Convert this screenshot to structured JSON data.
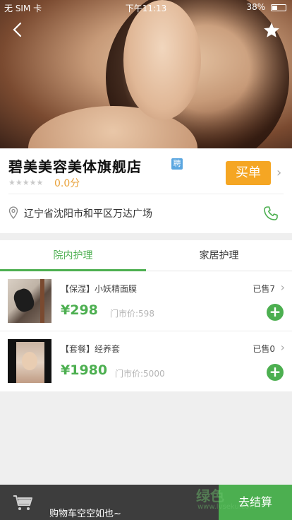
{
  "status_bar": {
    "carrier": "无 SIM 卡",
    "time": "下午11:13",
    "battery": "38%"
  },
  "store": {
    "name": "碧美美容美体旗舰店",
    "badge": "聘",
    "stars_display": "★★★★★",
    "rating": "0.0分",
    "buy_label": "买单",
    "address": "辽宁省沈阳市和平区万达广场"
  },
  "tabs": [
    {
      "label": "院内护理",
      "active": true
    },
    {
      "label": "家居护理",
      "active": false
    }
  ],
  "products": [
    {
      "title": "【保湿】小妖精面膜",
      "sold": "已售7",
      "price": "¥298",
      "original_price": "门市价:598"
    },
    {
      "title": "【套餐】经养套",
      "sold": "已售0",
      "price": "¥1980",
      "original_price": "门市价:5000"
    }
  ],
  "bottom_bar": {
    "cart_text": "购物车空空如也~",
    "checkout_label": "去结算"
  },
  "watermark": {
    "text": "绿色",
    "sub": "www.lvseku.com"
  },
  "colors": {
    "accent_green": "#4caf50",
    "buy_orange": "#f5a623",
    "rating_orange": "#e9a23b"
  }
}
